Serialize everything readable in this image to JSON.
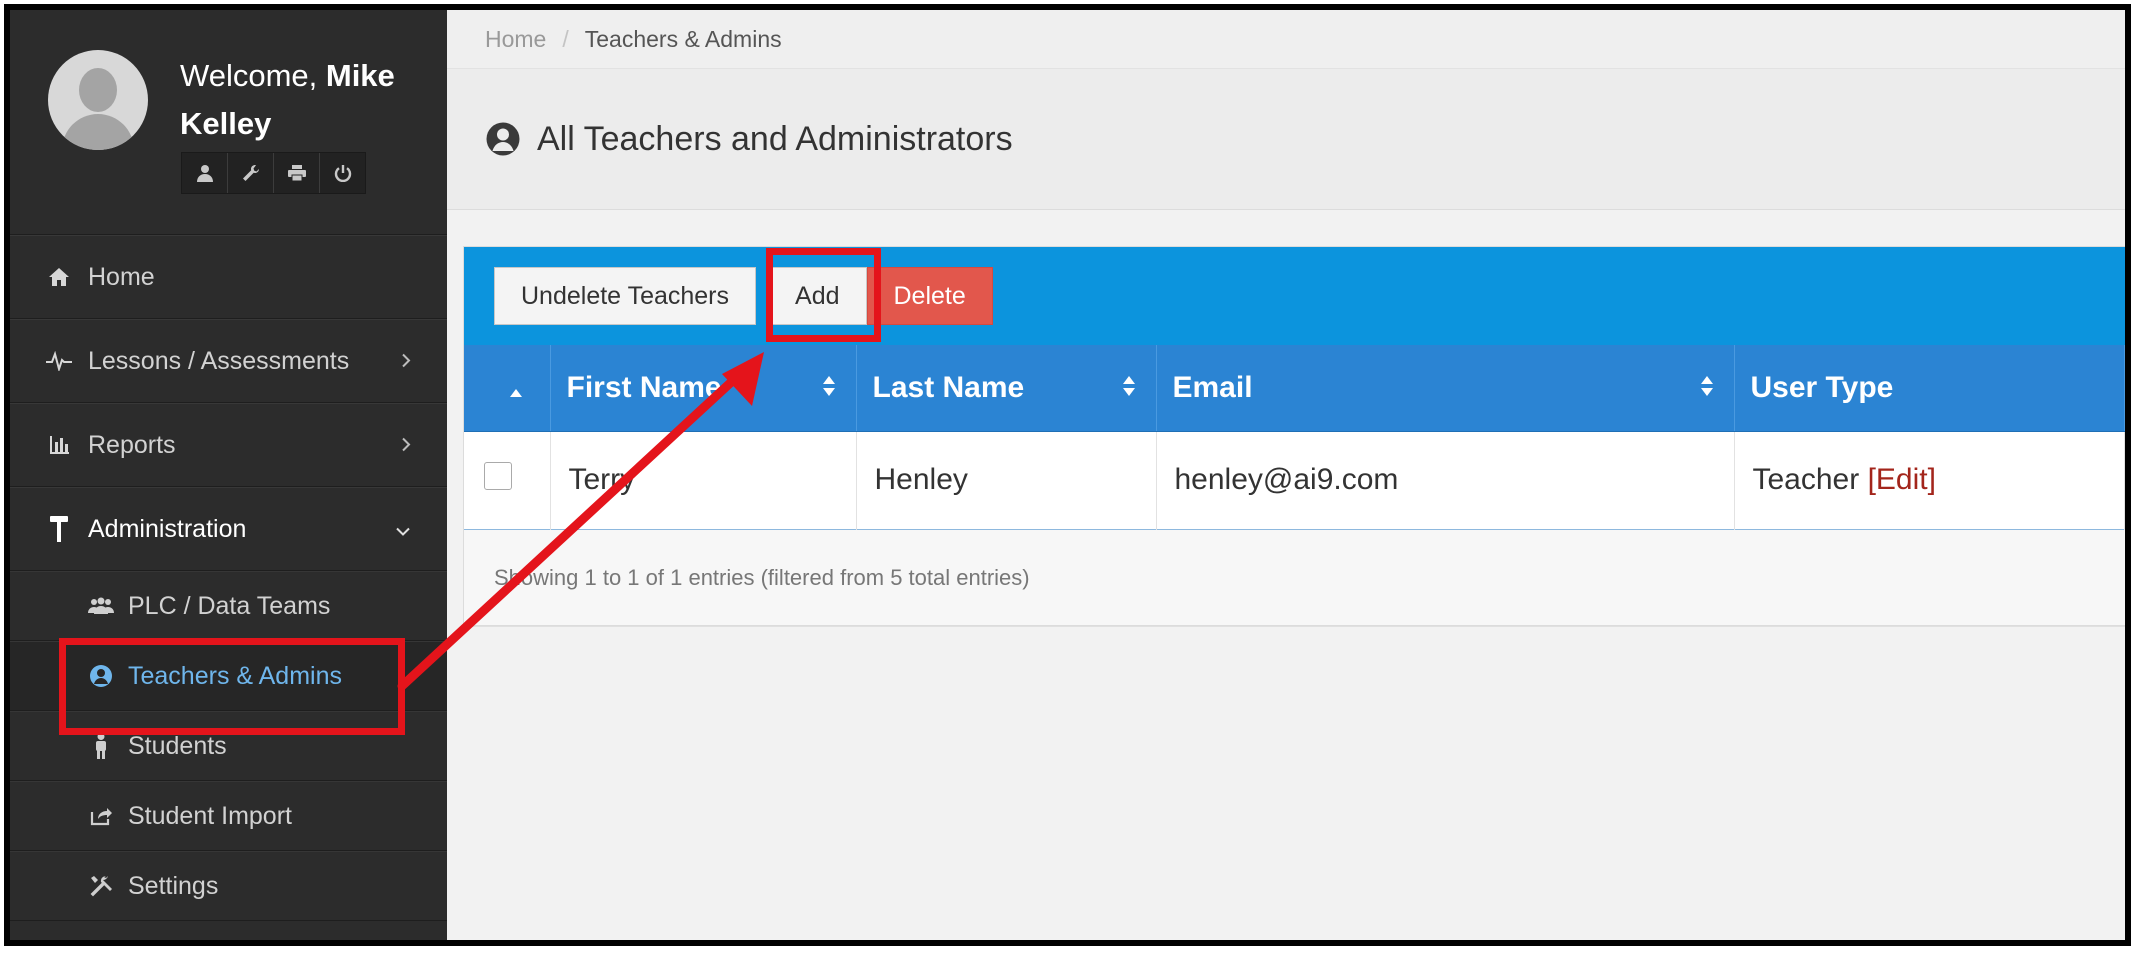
{
  "user": {
    "welcome_prefix": "Welcome,",
    "name": "Mike Kelley",
    "tools": [
      "user-icon",
      "wrench-icon",
      "print-icon",
      "power-icon"
    ]
  },
  "sidebar": {
    "items": [
      {
        "label": "Home",
        "icon": "home-icon"
      },
      {
        "label": "Lessons / Assessments",
        "icon": "pulse-icon",
        "has_children": true
      },
      {
        "label": "Reports",
        "icon": "bar-chart-icon",
        "has_children": true
      },
      {
        "label": "Administration",
        "icon": "hammer-icon",
        "expanded": true
      }
    ],
    "subitems": [
      {
        "label": "PLC / Data Teams",
        "icon": "team-icon"
      },
      {
        "label": "Teachers & Admins",
        "icon": "teacher-icon",
        "current": true
      },
      {
        "label": "Students",
        "icon": "student-icon"
      },
      {
        "label": "Student Import",
        "icon": "import-icon"
      },
      {
        "label": "Settings",
        "icon": "tools-icon"
      }
    ]
  },
  "breadcrumb": {
    "home": "Home",
    "separator": "/",
    "current": "Teachers & Admins"
  },
  "page": {
    "title": "All Teachers and Administrators",
    "icon": "teacher-icon"
  },
  "toolbar": {
    "undelete_label": "Undelete Teachers",
    "add_label": "Add",
    "delete_label": "Delete"
  },
  "table": {
    "columns": [
      "",
      "First Name",
      "Last Name",
      "Email",
      "User Type"
    ],
    "rows": [
      {
        "first_name": "Terry",
        "last_name": "Henley",
        "email": "henley@ai9.com",
        "user_type": "Teacher",
        "edit_label": "[Edit]"
      }
    ],
    "info": "Showing 1 to 1 of 1 entries (filtered from 5 total entries)"
  },
  "colors": {
    "sidebar_bg": "#2c2c2c",
    "toolbar_bg": "#0c94dd",
    "header_bg": "#2b84d3",
    "delete_bg": "#e2574c",
    "active_link": "#6fb6ec",
    "annotation": "#e4141b"
  }
}
